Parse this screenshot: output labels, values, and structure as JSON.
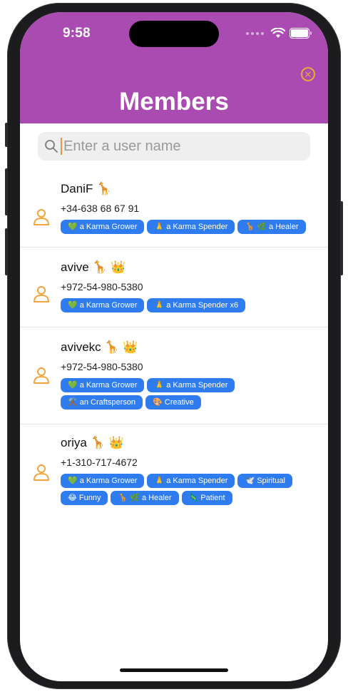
{
  "status": {
    "time": "9:58"
  },
  "header": {
    "title": "Members",
    "close_icon": "close-circle-icon",
    "bg_color": "#a94bb0",
    "accent_color": "#f2a33a"
  },
  "search": {
    "placeholder": "Enter a user name",
    "value": ""
  },
  "members": [
    {
      "name": "DaniF 🦒",
      "phone": "+34-638 68 67 91",
      "badges": [
        "💚 a Karma Grower",
        "🙏 a Karma Spender",
        "🦒 🌿 a Healer"
      ]
    },
    {
      "name": "avive 🦒 👑",
      "phone": "+972-54-980-5380",
      "badges": [
        "💚 a Karma Grower",
        "🙏 a Karma Spender x6"
      ]
    },
    {
      "name": "avivekc 🦒 👑",
      "phone": "+972-54-980-5380",
      "badges": [
        "💚 a Karma Grower",
        "🙏 a Karma Spender",
        "⚒️ an Craftsperson",
        "🎨 Creative"
      ]
    },
    {
      "name": "oriya 🦒 👑",
      "phone": "+1-310-717-4672",
      "badges": [
        "💚 a Karma Grower",
        "🙏 a Karma Spender",
        "🕊️ Spiritual",
        "😂 Funny",
        "🦒 🌿 a Healer",
        "🦎 Patient"
      ]
    }
  ],
  "badge_color": "#2f7bf0"
}
